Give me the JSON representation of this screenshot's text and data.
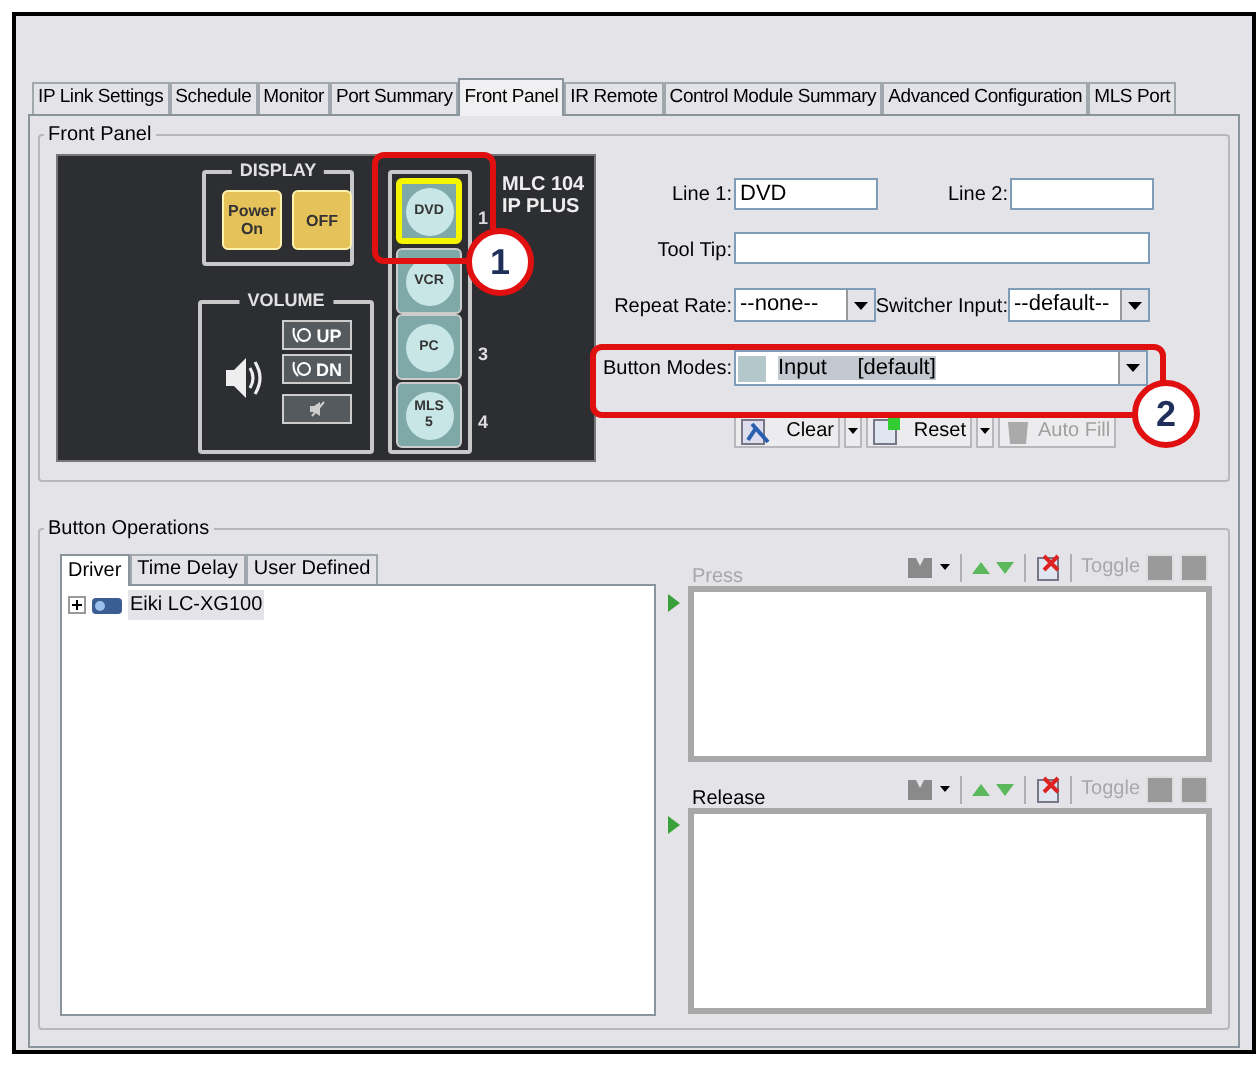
{
  "tabs": [
    {
      "label": "IP Link Settings",
      "selected": false
    },
    {
      "label": "Schedule",
      "selected": false
    },
    {
      "label": "Monitor",
      "selected": false
    },
    {
      "label": "Port Summary",
      "selected": false
    },
    {
      "label": "Front Panel",
      "selected": true
    },
    {
      "label": "IR Remote",
      "selected": false
    },
    {
      "label": "Control Module Summary",
      "selected": false
    },
    {
      "label": "Advanced Configuration",
      "selected": false
    },
    {
      "label": "MLS Port",
      "selected": false
    }
  ],
  "front_panel": {
    "title": "Front Panel",
    "device": {
      "model_lines": [
        "MLC 104",
        "IP PLUS"
      ],
      "display": {
        "title": "DISPLAY",
        "buttons": [
          {
            "lines": [
              "Power",
              "On"
            ]
          },
          {
            "lines": [
              "OFF"
            ]
          }
        ]
      },
      "volume": {
        "title": "VOLUME",
        "buttons": [
          {
            "kind": "up",
            "label": "UP"
          },
          {
            "kind": "down",
            "label": "DN"
          },
          {
            "kind": "mute"
          }
        ]
      },
      "inputs": [
        {
          "lines": [
            "DVD"
          ],
          "number": "1",
          "selected": true
        },
        {
          "lines": [
            "VCR"
          ],
          "selected": false
        },
        {
          "lines": [
            "PC"
          ],
          "number": "3",
          "selected": false
        },
        {
          "lines": [
            "MLS",
            "5"
          ],
          "number": "4",
          "selected": false
        }
      ]
    },
    "line1": {
      "label": "Line 1:",
      "value": "DVD"
    },
    "line2": {
      "label": "Line 2:"
    },
    "tool_tip": {
      "label": "Tool Tip:"
    },
    "repeat_rate": {
      "label": "Repeat Rate:",
      "value": "--none--"
    },
    "switcher_input": {
      "label": "Switcher Input:",
      "value": "--default--"
    },
    "button_modes": {
      "label": "Button Modes:",
      "value": "Input     [default]"
    },
    "actions": [
      {
        "kind": "clear",
        "label": "Clear",
        "disabled": false,
        "has_menu": true
      },
      {
        "kind": "reset",
        "label": "Reset",
        "disabled": false,
        "has_menu": true
      },
      {
        "kind": "autofill",
        "label": "Auto Fill",
        "disabled": true,
        "has_menu": false
      }
    ],
    "callouts": [
      "1",
      "2"
    ]
  },
  "button_operations": {
    "title": "Button Operations",
    "tabs": [
      {
        "label": "Driver",
        "selected": true
      },
      {
        "label": "Time Delay",
        "selected": false
      },
      {
        "label": "User Defined",
        "selected": false
      }
    ],
    "tree": [
      {
        "label": "Eiki LC-XG100",
        "expanded": false
      }
    ],
    "press": {
      "label": "Press",
      "disabled": true,
      "toggle": {
        "label": "Toggle",
        "disabled": true
      }
    },
    "release": {
      "label": "Release",
      "disabled": false,
      "toggle": {
        "label": "Toggle",
        "disabled": true
      }
    }
  }
}
